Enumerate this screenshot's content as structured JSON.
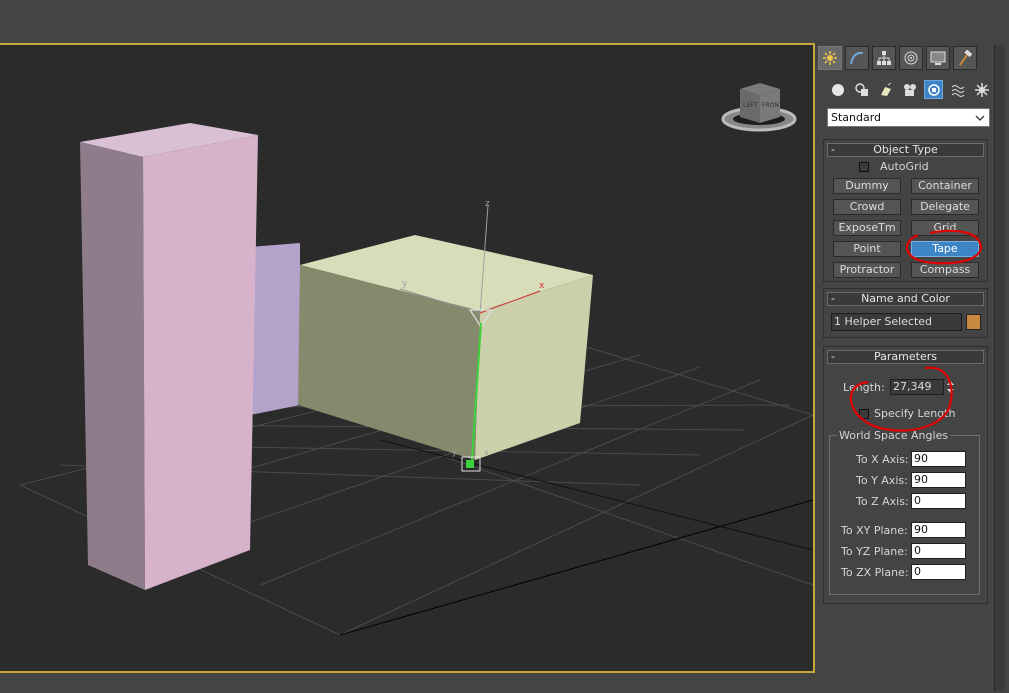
{
  "command_panel": {
    "tabs": [
      {
        "name": "create",
        "icon": "create-sun-icon"
      },
      {
        "name": "modify",
        "icon": "modify-curve-icon"
      },
      {
        "name": "hierarchy",
        "icon": "hierarchy-icon"
      },
      {
        "name": "motion",
        "icon": "motion-icon"
      },
      {
        "name": "display",
        "icon": "display-icon"
      },
      {
        "name": "utilities",
        "icon": "hammer-icon"
      }
    ],
    "categories": [
      {
        "name": "geometry",
        "icon": "sphere-icon"
      },
      {
        "name": "shapes",
        "icon": "shapes-icon"
      },
      {
        "name": "lights",
        "icon": "light-icon"
      },
      {
        "name": "cameras",
        "icon": "camera-icon"
      },
      {
        "name": "helpers",
        "icon": "helper-tape-icon"
      },
      {
        "name": "space-warps",
        "icon": "waves-icon"
      },
      {
        "name": "systems",
        "icon": "gear-icon"
      }
    ],
    "dropdown_value": "Standard",
    "object_type": {
      "title": "Object Type",
      "autogrid_label": "AutoGrid",
      "buttons": [
        "Dummy",
        "Container",
        "Crowd",
        "Delegate",
        "ExposeTm",
        "Grid",
        "Point",
        "Tape",
        "Protractor",
        "Compass"
      ],
      "active_button": "Tape"
    },
    "name_color": {
      "title": "Name and Color",
      "name_value": "1 Helper Selected",
      "swatch_color": "#c8893e"
    },
    "parameters": {
      "title": "Parameters",
      "length_label": "Length:",
      "length_value": "27,349",
      "specify_length_label": "Specify Length",
      "world_angles_title": "World Space Angles",
      "to_x_label": "To X Axis:",
      "to_x_value": "90",
      "to_y_label": "To Y Axis:",
      "to_y_value": "90",
      "to_z_label": "To Z Axis:",
      "to_z_value": "0",
      "to_xy_label": "To XY Plane:",
      "to_xy_value": "90",
      "to_yz_label": "To YZ Plane:",
      "to_yz_value": "0",
      "to_zx_label": "To ZX Plane:",
      "to_zx_value": "0"
    }
  },
  "viewport": {
    "viewcube_labels": {
      "left": "LEFT",
      "front": "FRONT"
    },
    "axis_labels": {
      "x": "x",
      "y": "y",
      "z": "z"
    },
    "colors": {
      "tall_box": "#d8b4cc",
      "back_box": "#b9a8d0",
      "wide_box": "#ccd1ad",
      "annotation": "#e00000",
      "border_active": "#c8a83a"
    }
  }
}
